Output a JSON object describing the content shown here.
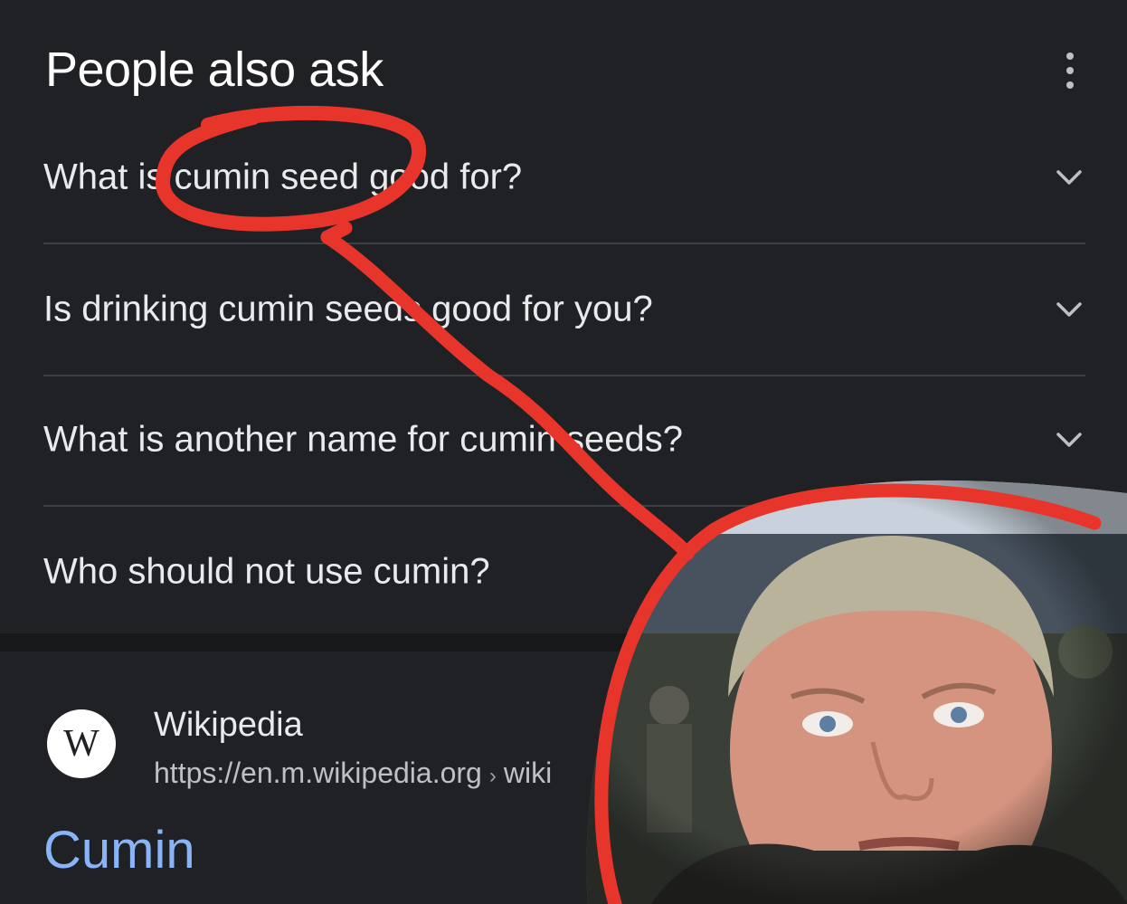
{
  "header": {
    "title": "People also ask",
    "more_icon": "vertical-dots-icon"
  },
  "questions": [
    {
      "text": "What is cumin seed good for?"
    },
    {
      "text": "Is drinking cumin seeds good for you?"
    },
    {
      "text": "What is another name for cumin seeds?"
    },
    {
      "text": "Who should not use cumin?"
    }
  ],
  "result": {
    "logo_letter": "W",
    "site_name": "Wikipedia",
    "url": "https://en.m.wikipedia.org",
    "url_path": "wiki",
    "title": "Cumin"
  },
  "colors": {
    "background": "#202124",
    "link": "#8ab4f8",
    "annotation": "#e8352b"
  }
}
